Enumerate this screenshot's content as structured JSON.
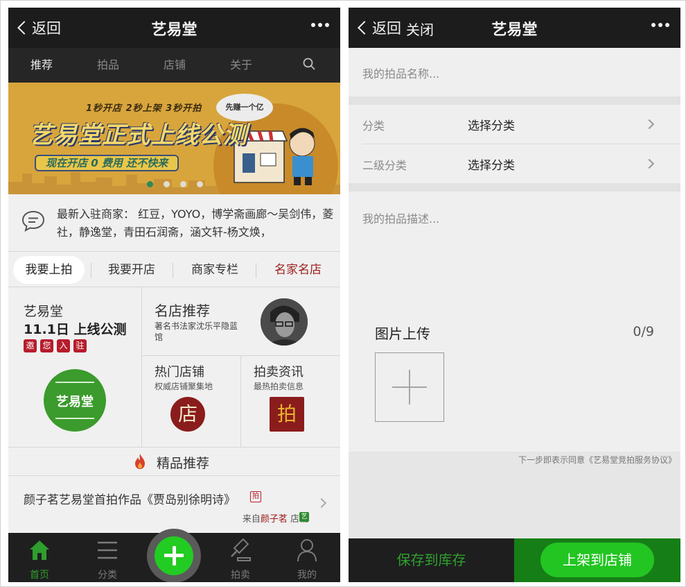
{
  "left": {
    "back_label": "返回",
    "title": "艺易堂",
    "tabs": [
      "推荐",
      "拍品",
      "店铺",
      "关于"
    ],
    "banner": {
      "steps": "1秒开店 2秒上架 3秒开拍",
      "headline": "艺易堂正式上线公测",
      "promo": "现在开店 0 费用  还不快来",
      "bubble": "先赚一个亿"
    },
    "notice": "最新入驻商家： 红豆，YOYO，博学斋画廊～吴剑伟，菱社，静逸堂，青田石润斋，涵文轩-杨文焕，",
    "quick_links": [
      "我要上拍",
      "我要开店",
      "商家专栏",
      "名家名店"
    ],
    "launch": {
      "name": "艺易堂",
      "date_line": "11.1日 上线公测",
      "invite_chars": [
        "邀",
        "您",
        "入",
        "驻"
      ],
      "logo_text": "艺易堂"
    },
    "famous_store": {
      "title": "名店推荐",
      "desc": "著名书法家沈乐平隐蓝馆"
    },
    "hot_store": {
      "title": "热门店铺",
      "desc": "权威店铺聚集地",
      "badge": "店"
    },
    "auction_news": {
      "title": "拍卖资讯",
      "desc": "最热拍卖信息",
      "badge": "拍"
    },
    "featured_title": "精品推荐",
    "featured_item": {
      "title": "颜子茗艺易堂首拍作品《贾岛别徐明诗》",
      "tag": "拍",
      "from_prefix": "来自",
      "author": "颜子茗",
      "from_suffix": "店铺",
      "shop_tag": "艺"
    },
    "bottom_nav": [
      "首页",
      "分类",
      "拍卖",
      "我的"
    ]
  },
  "right": {
    "back_label": "返回",
    "close_label": "关闭",
    "title": "艺易堂",
    "name_placeholder": "我的拍品名称...",
    "category_label": "分类",
    "category_value": "选择分类",
    "subcategory_label": "二级分类",
    "subcategory_value": "选择分类",
    "desc_placeholder": "我的拍品描述...",
    "upload_title": "图片上传",
    "upload_count": "0/9",
    "agreement": "下一步即表示同意《艺易堂竞拍服务协议》",
    "save_button": "保存到库存",
    "shelf_button": "上架到店铺"
  },
  "colors": {
    "accent_green": "#22cc22",
    "title_bar": "#1c1c1c",
    "brand_red": "#8a1c1c"
  }
}
